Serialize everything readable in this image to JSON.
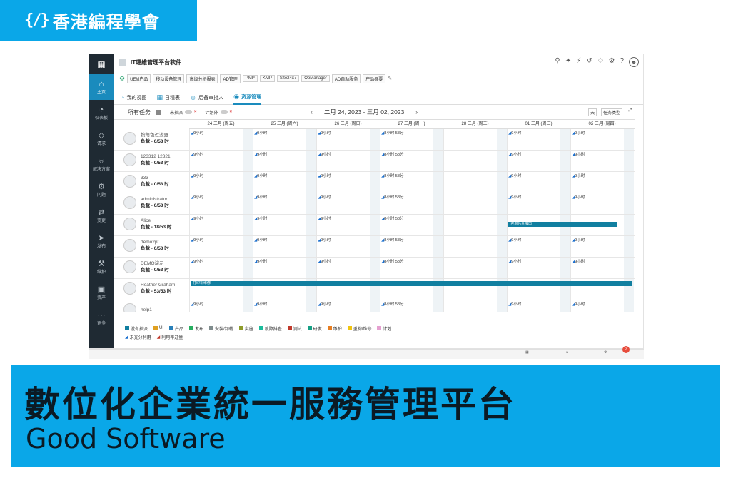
{
  "brand": {
    "logo": "{/}",
    "name": "香港編程學會"
  },
  "app": {
    "title": "IT運維管理平台软件",
    "nav": [
      {
        "icon": "home-icon",
        "label": "主页",
        "active": true
      },
      {
        "icon": "dashboard-icon",
        "label": "仪表板",
        "active": false
      },
      {
        "icon": "request-icon",
        "label": "请求",
        "active": false
      },
      {
        "icon": "solution-icon",
        "label": "解决方案",
        "active": false
      },
      {
        "icon": "problem-icon",
        "label": "问题",
        "active": false
      },
      {
        "icon": "change-icon",
        "label": "变更",
        "active": false
      },
      {
        "icon": "release-icon",
        "label": "发布",
        "active": false
      },
      {
        "icon": "maintenance-icon",
        "label": "维护",
        "active": false
      },
      {
        "icon": "asset-icon",
        "label": "资产",
        "active": false
      },
      {
        "icon": "more-icon",
        "label": "更多",
        "active": false
      }
    ],
    "products": [
      "UEM产品",
      "移动设备管理",
      "高级分析报表",
      "AD管理",
      "PMP",
      "KMP",
      "Site24x7",
      "OpManager",
      "AD自助服务",
      "产品概要"
    ],
    "tabs": [
      "我的视图",
      "日程表",
      "后备审批人",
      "资源管理"
    ],
    "filter": {
      "all_tasks": "所有任务",
      "unassigned": "未指派",
      "unplanned": "计划外",
      "date_range": "二月 24, 2023 - 三月 02, 2023",
      "view": "天",
      "task_type": "任务类型"
    },
    "days": [
      "24 二月 (周五)",
      "25 二月 (周六)",
      "26 二月 (周日)",
      "27 二月 (周一)",
      "28 二月 (周二)",
      "01 三月 (周三)",
      "02 三月 (周四)"
    ],
    "resources": [
      {
        "name": "按角色过滤器",
        "load": "负载 - 0/53 时",
        "hours": [
          "9小时",
          "9小时",
          "9小时",
          "8小时 58分",
          "",
          "9小时",
          "9小时"
        ]
      },
      {
        "name": "123312 12321",
        "load": "负载 - 0/53 时",
        "hours": [
          "9小时",
          "9小时",
          "9小时",
          "8小时 58分",
          "",
          "9小时",
          "9小时"
        ]
      },
      {
        "name": "333",
        "load": "负载 - 0/53 时",
        "hours": [
          "9小时",
          "9小时",
          "9小时",
          "8小时 58分",
          "",
          "9小时",
          "9小时"
        ]
      },
      {
        "name": "administrator",
        "load": "负载 - 0/53 时",
        "hours": [
          "9小时",
          "9小时",
          "9小时",
          "8小时 58分",
          "",
          "9小时",
          "9小时"
        ]
      },
      {
        "name": "Alice",
        "load": "负载 - 18/53 时",
        "hours": [
          "9小时",
          "9小时",
          "9小时",
          "8小时 58分",
          "",
          "",
          ""
        ]
      },
      {
        "name": "demo2pt",
        "load": "负载 - 0/53 时",
        "hours": [
          "9小时",
          "9小时",
          "9小时",
          "8小时 58分",
          "",
          "9小时",
          "9小时"
        ]
      },
      {
        "name": "DEMO演示",
        "load": "负载 - 0/53 时",
        "hours": [
          "9小时",
          "9小时",
          "9小时",
          "8小时 58分",
          "",
          "9小时",
          "9小时"
        ]
      },
      {
        "name": "Heather Graham",
        "load": "负载 - 53/53 时",
        "hours": [
          "",
          "",
          "",
          "",
          "",
          "",
          ""
        ]
      },
      {
        "name": "help1",
        "load": "",
        "hours": [
          "9小时",
          "9小时",
          "9小时",
          "8小时 58分",
          "",
          "9小时",
          "9小时"
        ]
      }
    ],
    "tasks": [
      {
        "label": "咨询后台接口",
        "row": 4
      },
      {
        "label": "打印机维修",
        "row": 7
      }
    ],
    "legend_row1": [
      {
        "label": "没有指派",
        "color": "#117fa0"
      },
      {
        "label": "UI",
        "color": "#e0a020"
      },
      {
        "label": "产品",
        "color": "#2980b9"
      },
      {
        "label": "发布",
        "color": "#27ae60"
      },
      {
        "label": "安装/卸载",
        "color": "#7f8c8d"
      },
      {
        "label": "实施",
        "color": "#8e9c2a"
      },
      {
        "label": "故障排查",
        "color": "#1abc9c"
      },
      {
        "label": "测试",
        "color": "#c0392b"
      },
      {
        "label": "研发",
        "color": "#16a085"
      },
      {
        "label": "维护",
        "color": "#e67e22"
      },
      {
        "label": "重构/维修",
        "color": "#f1c40f"
      },
      {
        "label": "计划",
        "color": "#e5a0d0"
      }
    ],
    "legend_row2": [
      "未充分利用",
      "利用率过量"
    ],
    "notif_count": "2"
  },
  "banner": {
    "headline": "數位化企業統一服務管理平台",
    "subtitle": "Good Software"
  }
}
